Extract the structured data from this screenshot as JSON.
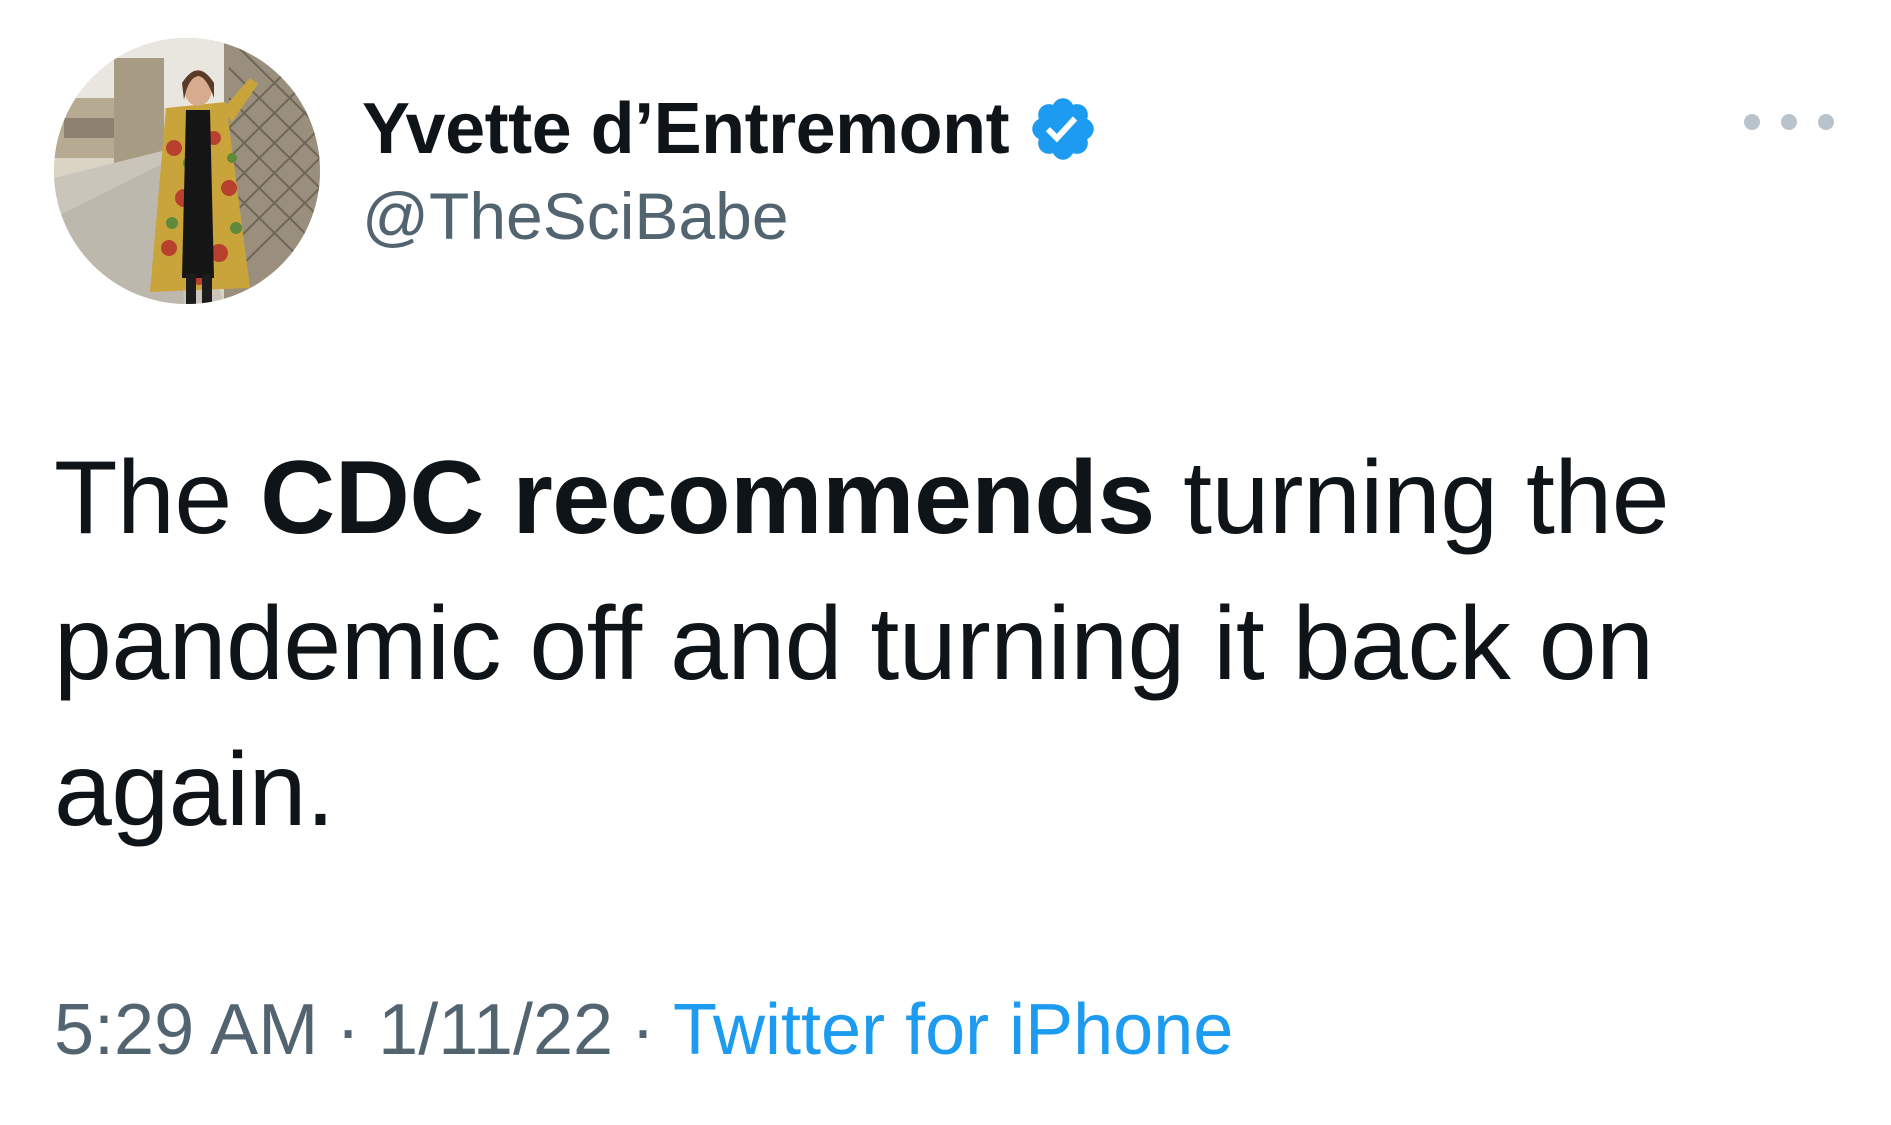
{
  "tweet": {
    "author": {
      "display_name": "Yvette d’Entremont",
      "handle": "@TheSciBabe",
      "verified": true,
      "avatar_icon": "profile-photo"
    },
    "more_icon": "more-options-icon",
    "text": {
      "part1": "The ",
      "part2_bold": "CDC recommends",
      "part3": " turning the pandemic off and turning it back on again."
    },
    "meta": {
      "time": "5:29 AM",
      "separator": "·",
      "date": "1/11/22",
      "source": "Twitter for iPhone"
    },
    "colors": {
      "text": "#0f1419",
      "secondary": "#536471",
      "accent": "#1d9bf0",
      "badge": "#1d9bf0"
    }
  }
}
